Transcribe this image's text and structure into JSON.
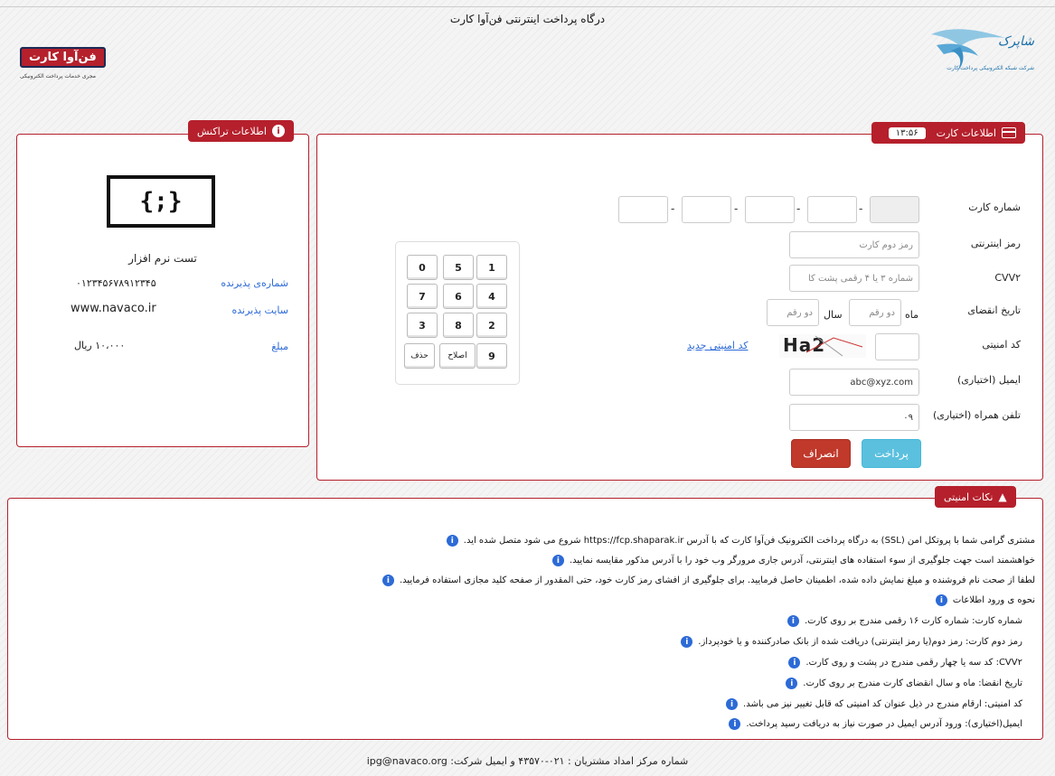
{
  "header": {
    "title": "درگاه پرداخت اینترنتی فن‌آوا کارت",
    "shaparak_logo_text": "شاپرک",
    "shaparak_logo_sub": "شرکت شبکه الکترونیکی پرداخت کارت",
    "fanava_logo_text": "فن‌آوا کارت",
    "fanava_logo_sub": "مجری خدمات پرداخت الکترونیکی"
  },
  "card_panel": {
    "tab_label": "اطلاعات کارت",
    "timer": "۱۳:۵۶",
    "fields": {
      "card_number_label": "شماره کارت",
      "pin_label": "رمز اینترنتی",
      "pin_placeholder": "رمز دوم کارت",
      "cvv_label": "CVV۲",
      "cvv_placeholder": "شماره ۳ یا ۴ رقمی پشت کا",
      "expiry_label": "تاریخ انقضای",
      "month_label": "ماه",
      "month_placeholder": "دو رقم",
      "year_label": "سال",
      "year_placeholder": "دو رقم",
      "captcha_label": "کد امنیتی",
      "captcha_text": "Ha2",
      "captcha_refresh": "کد امنیتی جدید",
      "email_label": "ایمیل (اختیاری)",
      "email_value": "abc@xyz.com",
      "phone_label": "تلفن همراه (اختیاری)",
      "phone_value": "۰۹"
    },
    "pay_button": "پرداخت",
    "cancel_button": "انصراف",
    "keypad": {
      "rows": [
        [
          "1",
          "5",
          "0"
        ],
        [
          "4",
          "6",
          "7"
        ],
        [
          "2",
          "8",
          "3"
        ],
        [
          "9",
          "اصلاح",
          "حذف"
        ]
      ]
    }
  },
  "transaction_panel": {
    "tab_label": "اطلاعات تراکنش",
    "merchant_logo": "{;}",
    "merchant_name": "تست نرم افزار",
    "merchant_number_label": "شماره‌ی پذیرنده",
    "merchant_number": "۰۱۲۳۴۵۶۷۸۹۱۲۳۴۵",
    "merchant_site_label": "سایت پذیرنده",
    "merchant_site": "www.navaco.ir",
    "amount_label": "مبلغ",
    "amount": "۱۰،۰۰۰ ریال"
  },
  "security": {
    "tab_label": "نکات امنیتی",
    "tips": [
      "مشتری گرامی شما با پروتکل امن (SSL) به درگاه پرداخت الکترونیک فن‌آوا کارت که با آدرس https://fcp.shaparak.ir شروع می شود متصل شده اید.",
      "خواهشمند است جهت جلوگیری از سوء استفاده های اینترنتی، آدرس جاری مرورگر وب خود را با آدرس مذکور مقایسه نمایید.",
      "لطفا از صحت نام فروشنده و مبلغ نمایش داده شده، اطمینان حاصل فرمایید. برای جلوگیری از افشای رمز کارت خود، حتی المقدور از صفحه کلید مجازی استفاده فرمایید.",
      "نحوه ی ورود اطلاعات"
    ],
    "sub_tips": [
      "شماره کارت: شماره کارت ۱۶ رقمی مندرج بر روی کارت.",
      "رمز دوم کارت: رمز دوم(یا رمز اینترنتی) دریافت شده از بانک صادرکننده و یا خودپرداز.",
      "CVV۲: کد سه یا چهار رقمی مندرج در پشت و روی کارت.",
      "تاریخ انقضا: ماه و سال انقضای کارت مندرج بر روی کارت.",
      "کد امنیتی: ارقام مندرج در ذیل عنوان کد امنیتی که قابل تغییر نیز می باشد.",
      "ایمیل(اختیاری): ورود آدرس ایمیل در صورت نیاز به دریافت رسید پرداخت."
    ]
  },
  "footer": {
    "text": "شماره مرکز امداد مشتریان : ۰۲۱-۴۳۵۷۰ و ایمیل شرکت: ipg@navaco.org"
  },
  "icons": {
    "info": "info-icon",
    "card": "credit-card-icon",
    "warning": "warning-icon"
  },
  "colors": {
    "accent": "#b5202c",
    "pay": "#5bc0de",
    "link": "#2c6ad6"
  }
}
